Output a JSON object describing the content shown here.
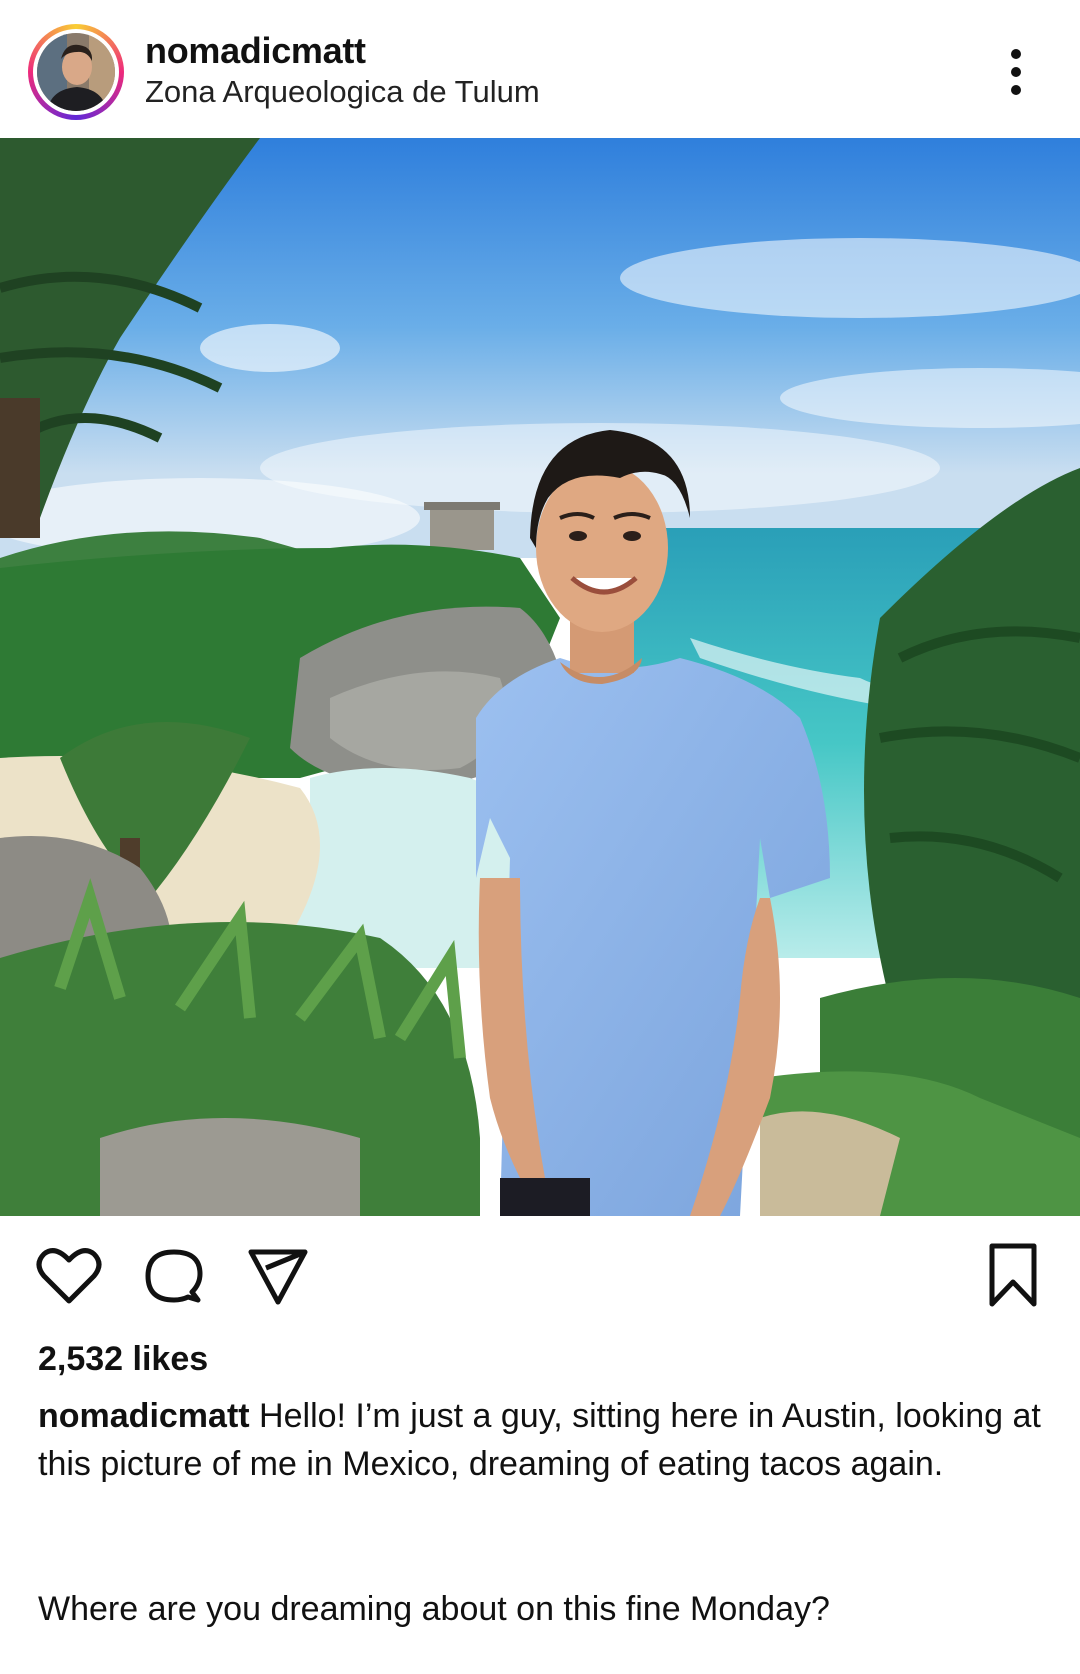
{
  "post": {
    "username": "nomadicmatt",
    "location": "Zona Arqueologica de Tulum",
    "likes": "2,532 likes",
    "caption_author": "nomadicmatt",
    "caption_text": "Hello! I’m just a guy, sitting here in Austin, looking at this picture of me in Mexico, dreaming of eating tacos again.",
    "caption_question": "Where are you dreaming about on this fine Monday?"
  },
  "icons": {
    "more": "more-vertical-icon",
    "like": "heart-icon",
    "comment": "comment-icon",
    "share": "send-icon",
    "save": "bookmark-icon"
  },
  "colors": {
    "text": "#111111",
    "sky": "#3d8fe0",
    "sea": "#3fc4c8",
    "shirt": "#8fb6ea"
  }
}
